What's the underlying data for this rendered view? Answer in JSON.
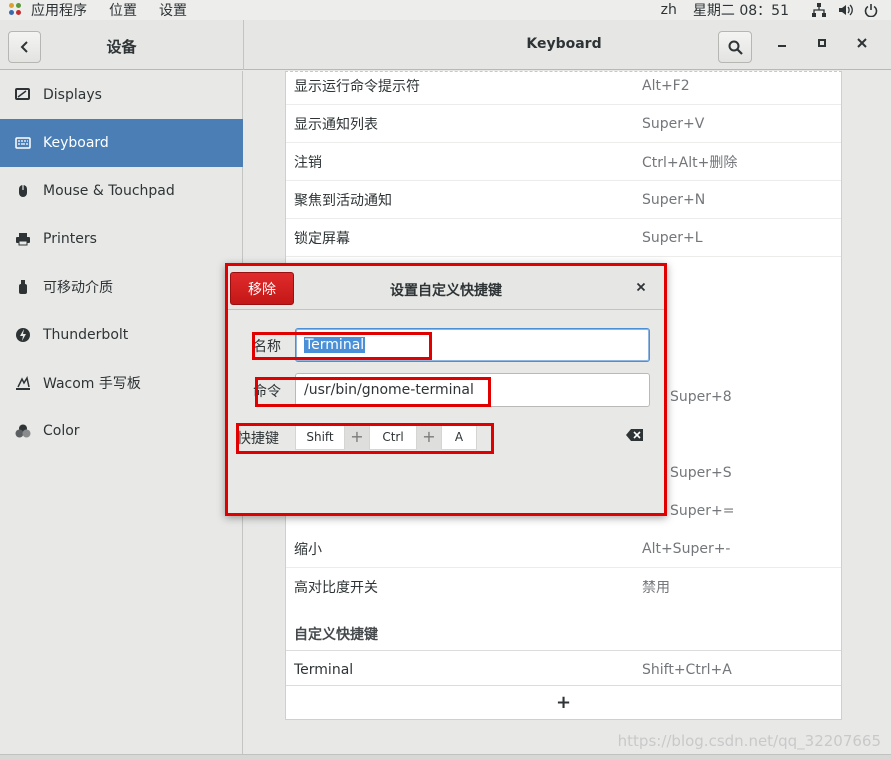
{
  "topbar": {
    "menus": [
      "应用程序",
      "位置",
      "设置"
    ],
    "lang": "zh",
    "clock": "星期二 08：51",
    "icons": [
      "network-icon",
      "volume-icon",
      "power-icon"
    ]
  },
  "header": {
    "left_title": "设备",
    "main_title": "Keyboard"
  },
  "sidebar": {
    "items": [
      {
        "label": "Displays",
        "icon": "display-icon"
      },
      {
        "label": "Keyboard",
        "icon": "keyboard-icon",
        "active": true
      },
      {
        "label": "Mouse & Touchpad",
        "icon": "mouse-icon"
      },
      {
        "label": "Printers",
        "icon": "printer-icon"
      },
      {
        "label": "可移动介质",
        "icon": "usb-icon"
      },
      {
        "label": "Thunderbolt",
        "icon": "thunderbolt-icon"
      },
      {
        "label": "Wacom 手写板",
        "icon": "tablet-icon"
      },
      {
        "label": "Color",
        "icon": "color-icon"
      }
    ]
  },
  "shortcuts": {
    "rows": [
      {
        "label": "显示运行命令提示符",
        "accel": "Alt+F2"
      },
      {
        "label": "显示通知列表",
        "accel": "Super+V"
      },
      {
        "label": "注销",
        "accel": "Ctrl+Alt+删除"
      },
      {
        "label": "聚焦到活动通知",
        "accel": "Super+N"
      },
      {
        "label": "锁定屏幕",
        "accel": "Super+L"
      }
    ],
    "partial_accels": [
      "Super+8",
      "Super+S",
      "Super+="
    ],
    "lower_rows": [
      {
        "label": "缩小",
        "accel": "Alt+Super+-"
      },
      {
        "label": "高对比度开关",
        "accel": "禁用"
      }
    ],
    "custom_section": "自定义快捷键",
    "custom_rows": [
      {
        "label": "Terminal",
        "accel": "Shift+Ctrl+A"
      }
    ],
    "add_label": "+"
  },
  "dialog": {
    "remove_label": "移除",
    "title": "设置自定义快捷键",
    "close_label": "×",
    "name_label": "名称",
    "name_value": "Terminal",
    "command_label": "命令",
    "command_value": "/usr/bin/gnome-terminal",
    "shortcut_label": "快捷键",
    "keys": [
      "Shift",
      "Ctrl",
      "A"
    ],
    "plus": "+"
  },
  "watermark": "https://blog.csdn.net/qq_32207665",
  "colors": {
    "accent": "#4a7eb5",
    "danger": "#e00000",
    "remove_button": "#d32020"
  }
}
